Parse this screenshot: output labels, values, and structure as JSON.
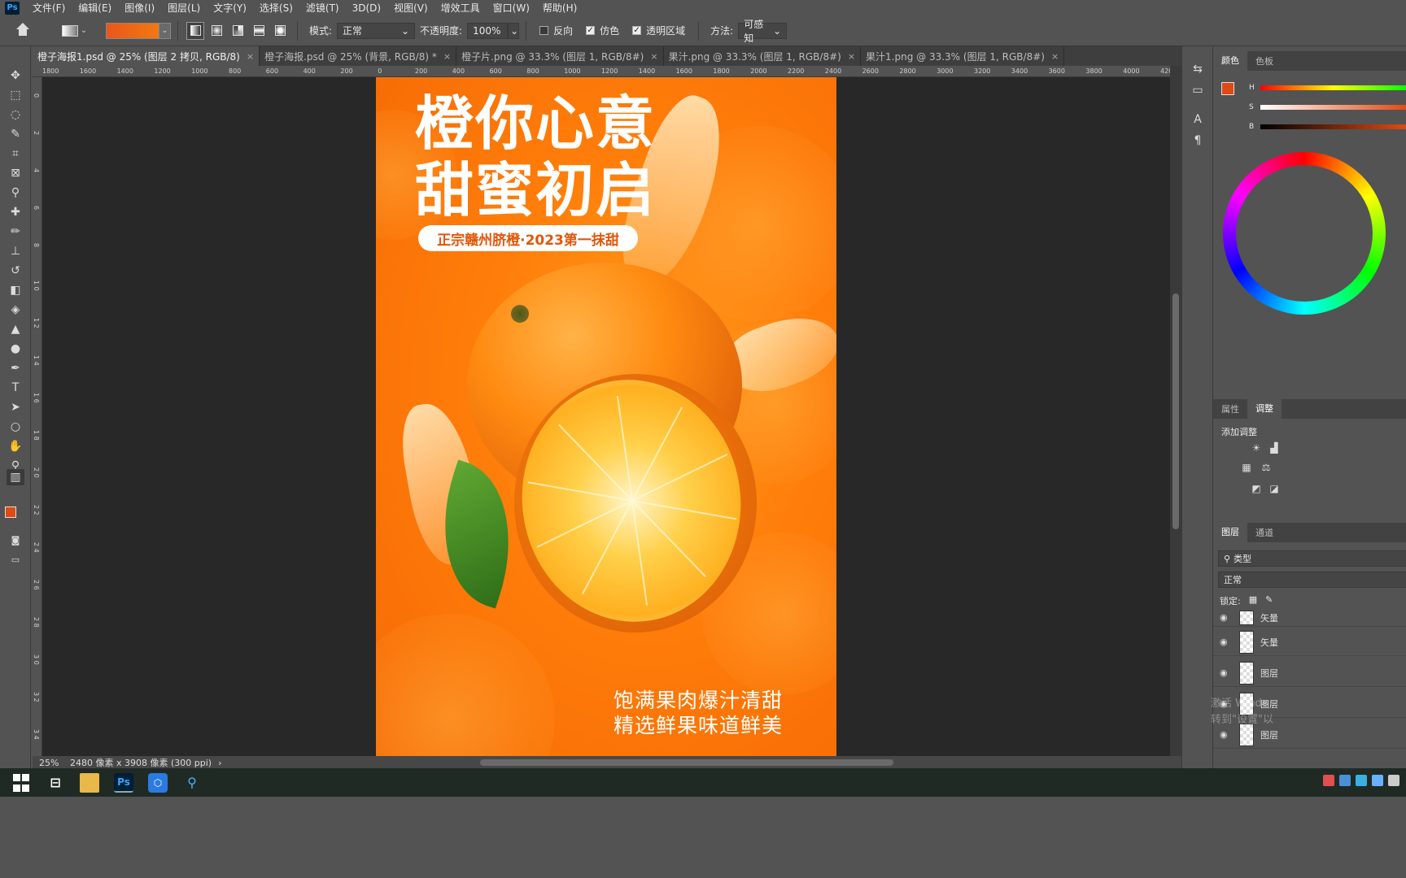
{
  "menubar": {
    "logo": "Ps",
    "items": [
      "文件(F)",
      "编辑(E)",
      "图像(I)",
      "图层(L)",
      "文字(Y)",
      "选择(S)",
      "滤镜(T)",
      "3D(D)",
      "视图(V)",
      "增效工具",
      "窗口(W)",
      "帮助(H)"
    ]
  },
  "options": {
    "mode_label": "模式:",
    "mode_value": "正常",
    "opacity_label": "不透明度:",
    "opacity_value": "100%",
    "reverse_label": "反向",
    "reverse_checked": false,
    "dither_label": "仿色",
    "dither_checked": true,
    "transparency_label": "透明区域",
    "transparency_checked": true,
    "method_label": "方法:",
    "method_value": "可感知",
    "gradient_color": "#e8571a"
  },
  "tabs": [
    {
      "label": "橙子海报1.psd @ 25% (图层 2 拷贝, RGB/8)",
      "active": true
    },
    {
      "label": "橙子海报.psd @ 25% (背景, RGB/8) *",
      "active": false
    },
    {
      "label": "橙子片.png @ 33.3% (图层 1, RGB/8#)",
      "active": false
    },
    {
      "label": "果汁.png @ 33.3% (图层 1, RGB/8#)",
      "active": false
    },
    {
      "label": "果汁1.png @ 33.3% (图层 1, RGB/8#)",
      "active": false
    }
  ],
  "ruler_top": [
    "1800",
    "1600",
    "1400",
    "1200",
    "1000",
    "800",
    "600",
    "400",
    "200",
    "0",
    "200",
    "400",
    "600",
    "800",
    "1000",
    "1200",
    "1400",
    "1600",
    "1800",
    "2000",
    "2200",
    "2400",
    "2600",
    "2800",
    "3000",
    "3200",
    "3400",
    "3600",
    "3800",
    "4000",
    "420"
  ],
  "ruler_left": [
    "0",
    "2",
    "4",
    "6",
    "8",
    "1 0",
    "1 2",
    "1 4",
    "1 6",
    "1 8",
    "2 0",
    "2 2",
    "2 4",
    "2 6",
    "2 8",
    "3 0",
    "3 2",
    "3 4",
    "3 6",
    "3 8"
  ],
  "poster": {
    "title_line1": "橙你心意",
    "title_line2": "甜蜜初启",
    "pill_text": "正宗赣州脐橙·2023第一抹甜",
    "sub_line1": "饱满果肉爆汁清甜",
    "sub_line2": "精选鲜果味道鲜美",
    "bg_color": "#ff7d0a"
  },
  "status": {
    "zoom": "25%",
    "doc_size": "2480 像素 x 3908 像素 (300 ppi)",
    "arrow": "›"
  },
  "right_panel": {
    "color_tab": "颜色",
    "swatches_tab": "色板",
    "h_label": "H",
    "s_label": "S",
    "b_label": "B",
    "fg_color": "#e04a12",
    "properties_tab": "属性",
    "adjust_tab": "调整",
    "add_adjust": "添加调整",
    "layers_tab": "图层",
    "channels_tab": "通道",
    "filter_kind": "类型",
    "blend_mode": "正常",
    "lock_label": "锁定:",
    "layers": [
      "矢量",
      "矢量",
      "图层",
      "图层",
      "图层"
    ]
  },
  "watermark": {
    "line1": "激活 Windo",
    "line2": "转到\"设置\"以"
  },
  "taskbar": {
    "ps_label": "Ps"
  },
  "toolbar_icons": [
    "move-icon",
    "marquee-icon",
    "lasso-icon",
    "quick-select-icon",
    "crop-icon",
    "frame-icon",
    "eyedropper-icon",
    "spot-heal-icon",
    "brush-icon",
    "stamp-icon",
    "history-brush-icon",
    "eraser-icon",
    "paint-bucket-icon",
    "blur-icon",
    "dodge-icon",
    "pen-icon",
    "type-icon",
    "path-select-icon",
    "ellipse-icon",
    "hand-icon",
    "zoom-icon",
    "gradient-icon"
  ]
}
